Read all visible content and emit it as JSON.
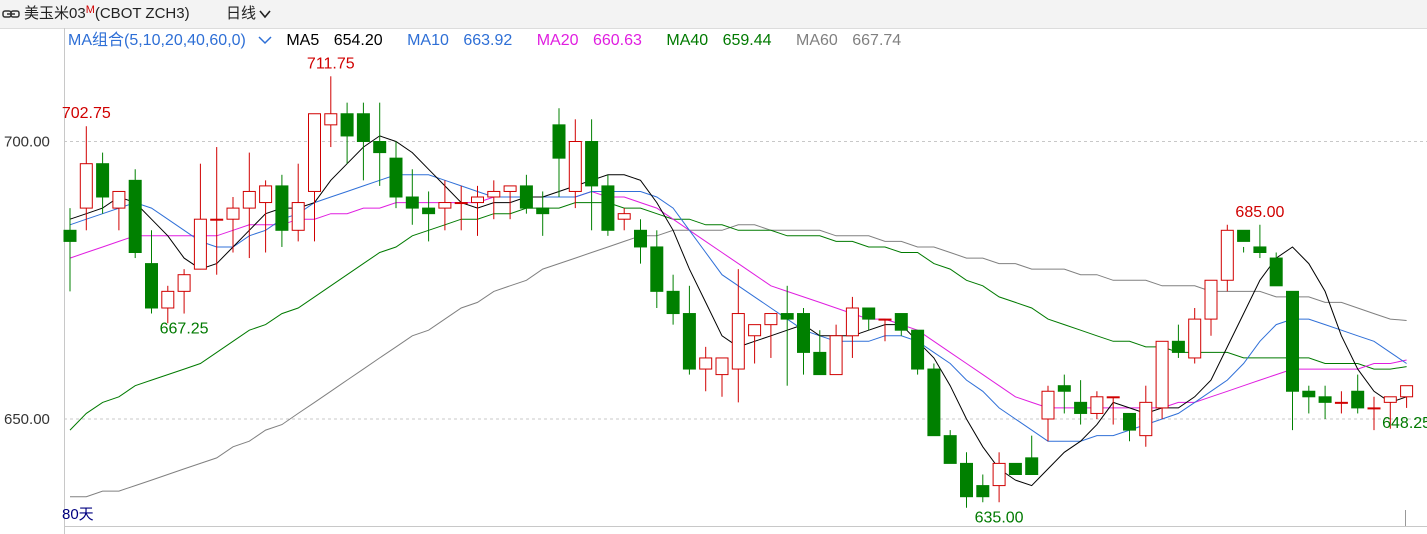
{
  "header": {
    "symbol": "美玉米03",
    "badge": "M",
    "code": "(CBOT ZCH3)",
    "period": "日线"
  },
  "ma_legend": {
    "combo": "MA组合(5,10,20,40,60,0)",
    "items": [
      {
        "label": "MA5",
        "value": "654.20",
        "color": "#000000"
      },
      {
        "label": "MA10",
        "value": "663.92",
        "color": "#2e6fd6"
      },
      {
        "label": "MA20",
        "value": "660.63",
        "color": "#e01ee0"
      },
      {
        "label": "MA40",
        "value": "659.44",
        "color": "#007a00"
      },
      {
        "label": "MA60",
        "value": "667.74",
        "color": "#808080"
      }
    ]
  },
  "footer": {
    "days": "80天"
  },
  "chart_data": {
    "type": "candlestick",
    "y_ticks": [
      "700.00",
      "650.00"
    ],
    "ylim": [
      630,
      714
    ],
    "annotations": [
      {
        "label": "702.75",
        "index": 1,
        "kind": "high"
      },
      {
        "label": "667.25",
        "index": 7,
        "kind": "low"
      },
      {
        "label": "711.75",
        "index": 16,
        "kind": "high"
      },
      {
        "label": "635.00",
        "index": 57,
        "kind": "low"
      },
      {
        "label": "685.00",
        "index": 73,
        "kind": "high"
      },
      {
        "label": "648.25",
        "index": 82,
        "kind": "low"
      }
    ],
    "colors": {
      "up": "#d00000",
      "down": "#008000",
      "ma5": "#000000",
      "ma10": "#3070d8",
      "ma20": "#e01ee0",
      "ma40": "#007a00",
      "ma60": "#808080"
    },
    "ohlc": [
      [
        684,
        688,
        673,
        682
      ],
      [
        688,
        702.75,
        684,
        696
      ],
      [
        696,
        698,
        687,
        690
      ],
      [
        688,
        691,
        684,
        691
      ],
      [
        693,
        695,
        679,
        680
      ],
      [
        678,
        684,
        669,
        670
      ],
      [
        670,
        674,
        667.25,
        673
      ],
      [
        673,
        677,
        669,
        676
      ],
      [
        677,
        696,
        677,
        686
      ],
      [
        686,
        699,
        676,
        686
      ],
      [
        686,
        690,
        680,
        688
      ],
      [
        688,
        698,
        679,
        691
      ],
      [
        689,
        693,
        680,
        692
      ],
      [
        692,
        694,
        681,
        684
      ],
      [
        684,
        696,
        682,
        689
      ],
      [
        691,
        703,
        682,
        705
      ],
      [
        703,
        711.75,
        699,
        705
      ],
      [
        705,
        707,
        696,
        701
      ],
      [
        705,
        707,
        693,
        700
      ],
      [
        700,
        707,
        692,
        698
      ],
      [
        697,
        700,
        688,
        690
      ],
      [
        690,
        695,
        685,
        688
      ],
      [
        688,
        691,
        682,
        687
      ],
      [
        688,
        693,
        684,
        689
      ],
      [
        689,
        692,
        684,
        689
      ],
      [
        689,
        692,
        683,
        690
      ],
      [
        690,
        693,
        686,
        691
      ],
      [
        691,
        692,
        686,
        692
      ],
      [
        692,
        694,
        687,
        688
      ],
      [
        688,
        691,
        683,
        687
      ],
      [
        703,
        706,
        690,
        697
      ],
      [
        691,
        704,
        688,
        700
      ],
      [
        700,
        704,
        684,
        692
      ],
      [
        692,
        694,
        683,
        684
      ],
      [
        686,
        688,
        684,
        687
      ],
      [
        684,
        686,
        678,
        681
      ],
      [
        681,
        684,
        670,
        673
      ],
      [
        673,
        676,
        667,
        669
      ],
      [
        669,
        674,
        658,
        659
      ],
      [
        659,
        663,
        655,
        661
      ],
      [
        658,
        660,
        654,
        661
      ],
      [
        659,
        677,
        653,
        669
      ],
      [
        665,
        667,
        660,
        667
      ],
      [
        667,
        669,
        661,
        669
      ],
      [
        669,
        674,
        656,
        668
      ],
      [
        669,
        670,
        658,
        662
      ],
      [
        662,
        666,
        658,
        658
      ],
      [
        658,
        667,
        658,
        665
      ],
      [
        665,
        672,
        661,
        670
      ],
      [
        670,
        670,
        666,
        668
      ],
      [
        668,
        668,
        664,
        668
      ],
      [
        669,
        668,
        665,
        666
      ],
      [
        666,
        666,
        658,
        659
      ],
      [
        659,
        660,
        647,
        647
      ],
      [
        647,
        648,
        643,
        642
      ],
      [
        642,
        644,
        634,
        636
      ],
      [
        638,
        640,
        635,
        636
      ],
      [
        638,
        644,
        635.0,
        642
      ],
      [
        642,
        642,
        640,
        640
      ],
      [
        643,
        647,
        640,
        640
      ],
      [
        650,
        656,
        646,
        655
      ],
      [
        656,
        658,
        651,
        655
      ],
      [
        653,
        657,
        649,
        651
      ],
      [
        651,
        655,
        650,
        654
      ],
      [
        654,
        654,
        649,
        654
      ],
      [
        651,
        651,
        646,
        648
      ],
      [
        647,
        656,
        645,
        653
      ],
      [
        652,
        664,
        650,
        664
      ],
      [
        664,
        667,
        661,
        662
      ],
      [
        661,
        670,
        660,
        668
      ],
      [
        668,
        675,
        665,
        675
      ],
      [
        675,
        685.0,
        673,
        684
      ],
      [
        684,
        681,
        680,
        682
      ],
      [
        681,
        685,
        679,
        680
      ],
      [
        679,
        674,
        680,
        674
      ],
      [
        673,
        673,
        648,
        655
      ],
      [
        655,
        656,
        651,
        654
      ],
      [
        654,
        656,
        650,
        653
      ],
      [
        653,
        655,
        651,
        653
      ],
      [
        655,
        658,
        651,
        652
      ],
      [
        652,
        654,
        648,
        652
      ],
      [
        653,
        654,
        648.25,
        654
      ],
      [
        654,
        656,
        652,
        656
      ]
    ],
    "ma_series": {
      "ma5": [
        686,
        687,
        688,
        690,
        689,
        686,
        683,
        679,
        677,
        678,
        681,
        684,
        687,
        688,
        688,
        689,
        693,
        696,
        699,
        701,
        700,
        698,
        695,
        692,
        689,
        688,
        689,
        689,
        690,
        690,
        691,
        692,
        693,
        694,
        694,
        693,
        689,
        684,
        677,
        671,
        665,
        663,
        664,
        665,
        666,
        667,
        665,
        665,
        665,
        666,
        667,
        667,
        664,
        661,
        656,
        650,
        645,
        641,
        639,
        638,
        641,
        644,
        646,
        649,
        653,
        652,
        651,
        652,
        652,
        654,
        657,
        663,
        669,
        675,
        679,
        681,
        678,
        673,
        665,
        659,
        655,
        653,
        654
      ],
      "ma10": [
        685,
        686,
        687,
        688,
        689,
        688,
        686,
        684,
        682,
        681,
        681,
        683,
        684,
        686,
        687,
        689,
        690,
        691,
        692,
        693,
        694,
        694,
        694,
        693,
        692,
        691,
        690,
        690,
        690,
        690,
        690,
        690,
        691,
        691,
        691,
        691,
        690,
        688,
        684,
        680,
        676,
        674,
        672,
        670,
        668,
        666,
        665,
        664,
        664,
        664,
        665,
        665,
        664,
        662,
        660,
        657,
        655,
        652,
        650,
        648,
        646,
        646,
        646,
        647,
        647,
        648,
        649,
        650,
        651,
        653,
        655,
        657,
        660,
        664,
        667,
        668,
        668,
        667,
        666,
        665,
        664,
        662,
        660
      ],
      "ma20": [
        679,
        680,
        681,
        682,
        683,
        683,
        683,
        683,
        683,
        683,
        684,
        685,
        685,
        685,
        686,
        686,
        687,
        687,
        688,
        688,
        689,
        689,
        689,
        689,
        689,
        689,
        690,
        690,
        690,
        690,
        690,
        690,
        691,
        690,
        690,
        689,
        688,
        686,
        684,
        682,
        680,
        678,
        676,
        674,
        673,
        672,
        671,
        670,
        669,
        668,
        668,
        667,
        666,
        664,
        662,
        660,
        658,
        656,
        654,
        653,
        652,
        652,
        652,
        652,
        652,
        652,
        652,
        652,
        653,
        653,
        654,
        655,
        656,
        657,
        658,
        659,
        659,
        659,
        659,
        659,
        660,
        660,
        660.63
      ],
      "ma40": [
        648,
        651,
        653,
        654,
        656,
        657,
        658,
        659,
        660,
        662,
        664,
        666,
        667,
        669,
        670,
        672,
        674,
        676,
        678,
        680,
        681,
        683,
        684,
        685,
        686,
        686,
        687,
        687,
        688,
        688,
        688,
        689,
        689,
        689,
        688,
        688,
        687,
        686,
        686,
        685,
        685,
        684,
        684,
        684,
        683,
        683,
        683,
        682,
        682,
        681,
        681,
        680,
        680,
        678,
        677,
        675,
        674,
        672,
        671,
        670,
        668,
        667,
        666,
        665,
        664,
        664,
        663,
        663,
        662,
        662,
        662,
        662,
        661,
        661,
        661,
        661,
        661,
        660,
        660,
        660,
        659,
        659,
        659.44
      ],
      "ma60": [
        636,
        636,
        637,
        637,
        638,
        639,
        640,
        641,
        642,
        643,
        645,
        646,
        648,
        649,
        651,
        653,
        655,
        657,
        659,
        661,
        663,
        665,
        666,
        668,
        670,
        671,
        673,
        674,
        675,
        677,
        678,
        679,
        680,
        681,
        682,
        683,
        683,
        684,
        684,
        684,
        684,
        685,
        685,
        684,
        684,
        684,
        684,
        683,
        683,
        683,
        682,
        682,
        681,
        681,
        680,
        679,
        679,
        678,
        678,
        677,
        677,
        677,
        676,
        676,
        675,
        675,
        675,
        674,
        674,
        674,
        673,
        673,
        673,
        673,
        672,
        672,
        672,
        671,
        671,
        670,
        669,
        668,
        667.74
      ]
    }
  }
}
